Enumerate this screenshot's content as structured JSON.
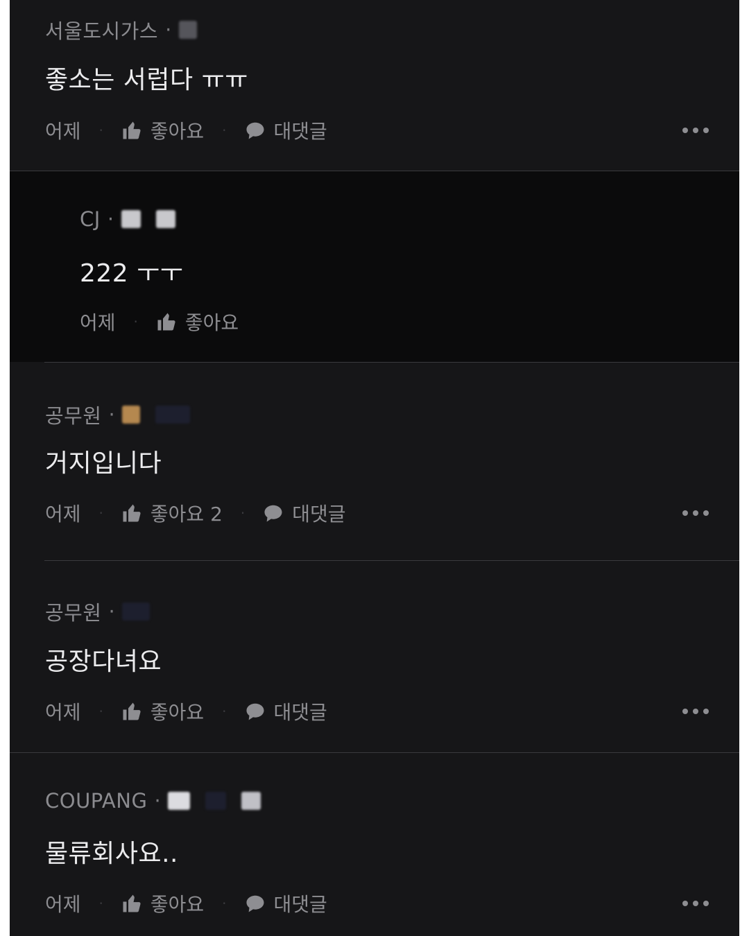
{
  "comments": [
    {
      "author": "서울도시가스",
      "text": "좋소는 서럽다 ㅠㅠ",
      "time": "어제",
      "like_label": "좋아요",
      "reply_label": "대댓글"
    },
    {
      "author": "CJ",
      "text": "222 ㅜㅜ",
      "time": "어제",
      "like_label": "좋아요"
    },
    {
      "author": "공무원",
      "text": "거지입니다",
      "time": "어제",
      "like_label": "좋아요 2",
      "reply_label": "대댓글"
    },
    {
      "author": "공무원",
      "text": "공장다녀요",
      "time": "어제",
      "like_label": "좋아요",
      "reply_label": "대댓글"
    },
    {
      "author": "COUPANG",
      "text": "물류회사요..",
      "time": "어제",
      "like_label": "좋아요",
      "reply_label": "대댓글"
    }
  ],
  "separator": "·",
  "icons": {
    "like": "thumbs-up-icon",
    "reply": "speech-bubble-icon",
    "more": "more-dots-icon"
  },
  "colors": {
    "background": "#161618",
    "reply_background": "#0b0b0c",
    "primary_text": "#ececee",
    "secondary_text": "#8b8b8f"
  }
}
